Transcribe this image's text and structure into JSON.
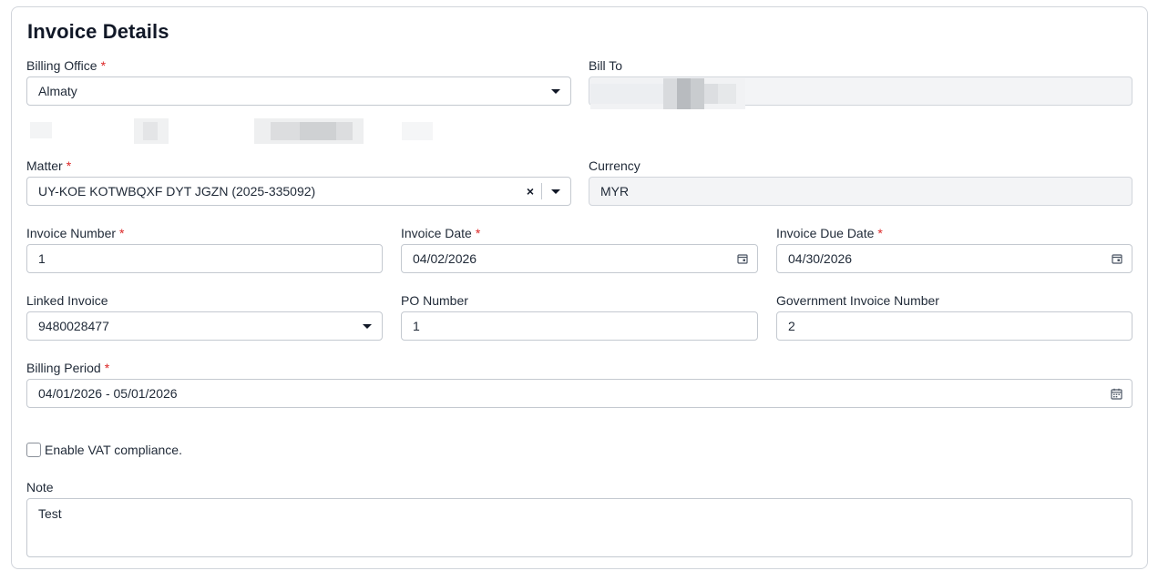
{
  "form": {
    "title": "Invoice Details",
    "required_mark": "*",
    "billing_office": {
      "label": "Billing Office",
      "value": "Almaty"
    },
    "bill_to": {
      "label": "Bill To",
      "value": ""
    },
    "matter": {
      "label": "Matter",
      "value": "UY-KOE KOTWBQXF DYT JGZN (2025-335092)",
      "clear": "×"
    },
    "currency": {
      "label": "Currency",
      "value": "MYR"
    },
    "invoice_number": {
      "label": "Invoice Number",
      "value": "1"
    },
    "invoice_date": {
      "label": "Invoice Date",
      "value": "04/02/2026"
    },
    "invoice_due_date": {
      "label": "Invoice Due Date",
      "value": "04/30/2026"
    },
    "linked_invoice": {
      "label": "Linked Invoice",
      "value": "9480028477"
    },
    "po_number": {
      "label": "PO Number",
      "value": "1"
    },
    "government_invoice_number": {
      "label": "Government Invoice Number",
      "value": "2"
    },
    "billing_period": {
      "label": "Billing Period",
      "value": "04/01/2026 - 05/01/2026"
    },
    "vat": {
      "label": "Enable VAT compliance.",
      "checked": false
    },
    "note": {
      "label": "Note",
      "value": "Test"
    }
  }
}
